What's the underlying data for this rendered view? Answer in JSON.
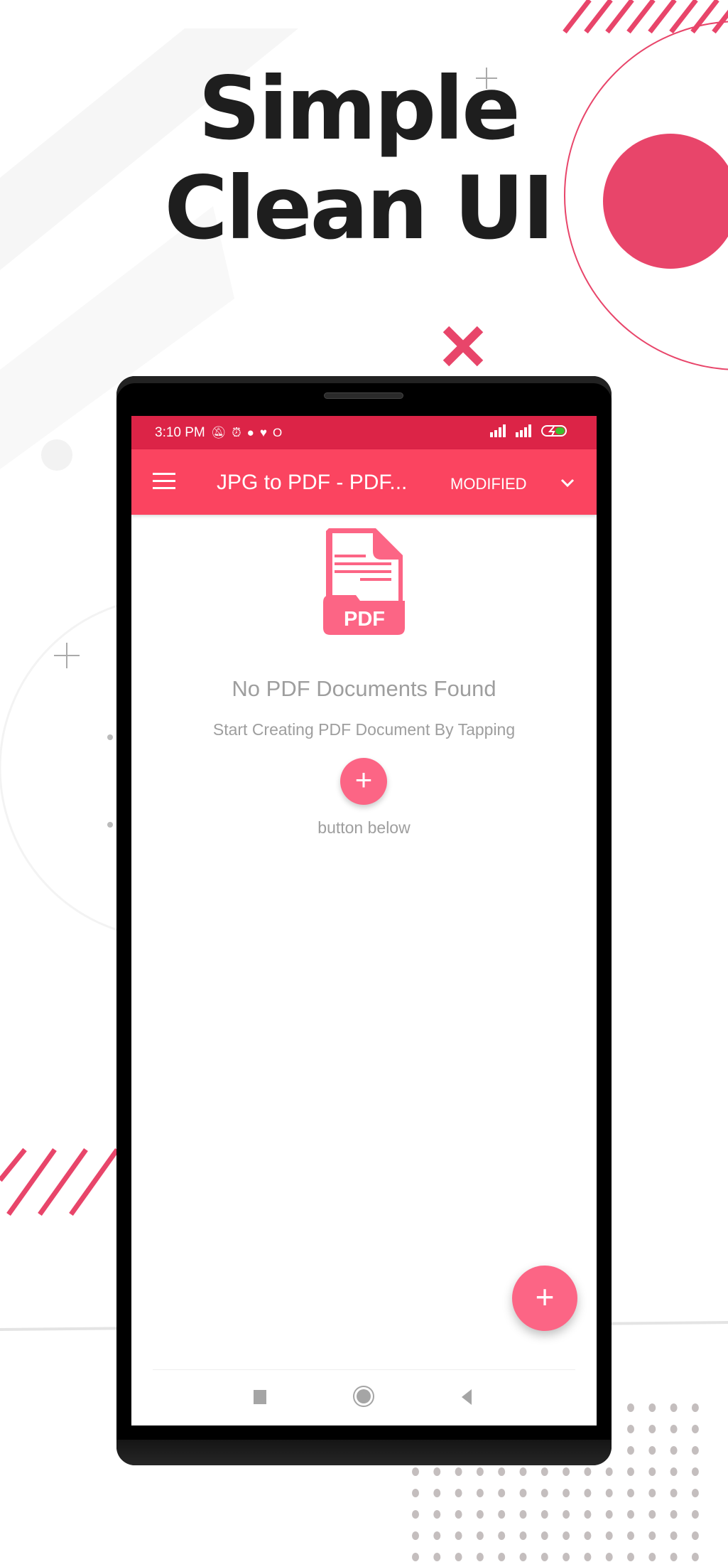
{
  "headline": {
    "line1": "Simple",
    "line2": "Clean UI"
  },
  "colors": {
    "accent": "#fb4460",
    "status_bar": "#dc2447",
    "fab": "#fc6585",
    "decor": "#e8456a"
  },
  "status_bar": {
    "time": "3:10 PM",
    "icons": [
      "bell-off-icon",
      "alarm-icon",
      "app-icon",
      "heart-icon",
      "opera-icon",
      "signal-icon",
      "signal-icon",
      "battery-charging-icon"
    ]
  },
  "app_bar": {
    "title": "JPG to PDF - PDF...",
    "sort_label": "MODIFIED",
    "menu_icon": "hamburger-icon",
    "dropdown_icon": "chevron-down-icon"
  },
  "empty_state": {
    "icon_label": "PDF",
    "title": "No PDF Documents Found",
    "subtitle": "Start Creating PDF Document By Tapping",
    "subtitle_end": "button below",
    "inline_button": "+"
  },
  "fab": {
    "label": "+"
  }
}
